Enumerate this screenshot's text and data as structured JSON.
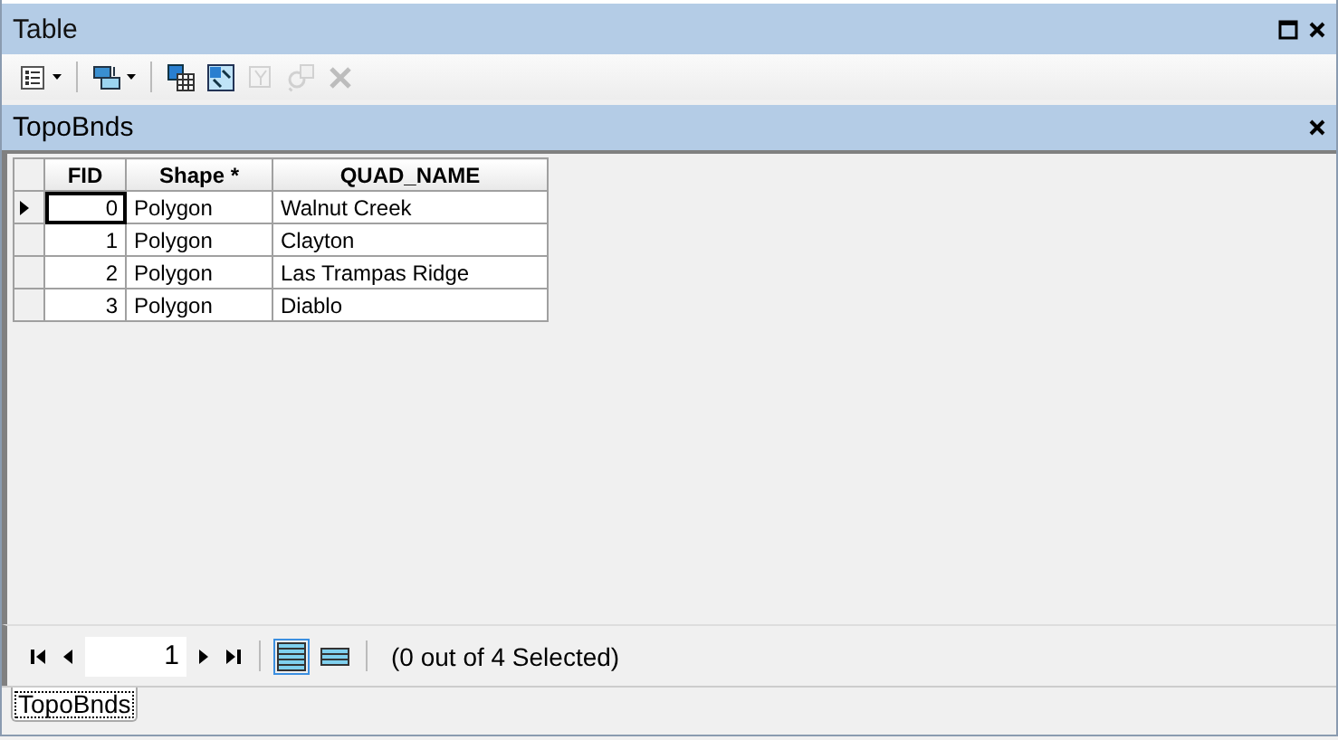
{
  "window": {
    "title": "Table"
  },
  "toolbar": [
    {
      "kind": "options",
      "dropdown": true,
      "disabled": false
    },
    {
      "kind": "related",
      "dropdown": true,
      "disabled": false
    },
    {
      "kind": "select",
      "dropdown": false,
      "disabled": false
    },
    {
      "kind": "switch",
      "dropdown": false,
      "disabled": false
    },
    {
      "kind": "clear",
      "dropdown": false,
      "disabled": true
    },
    {
      "kind": "zoom",
      "dropdown": false,
      "disabled": true
    },
    {
      "kind": "delete",
      "dropdown": false,
      "disabled": true
    }
  ],
  "table_tab": {
    "title": "TopoBnds"
  },
  "table": {
    "columns": [
      {
        "label": "FID"
      },
      {
        "label": "Shape *"
      },
      {
        "label": "QUAD_NAME"
      }
    ],
    "rows": [
      {
        "current": true,
        "cells": [
          "0",
          "Polygon",
          "Walnut Creek"
        ]
      },
      {
        "current": false,
        "cells": [
          "1",
          "Polygon",
          "Clayton"
        ]
      },
      {
        "current": false,
        "cells": [
          "2",
          "Polygon",
          "Las Trampas Ridge"
        ]
      },
      {
        "current": false,
        "cells": [
          "3",
          "Polygon",
          "Diablo"
        ]
      }
    ]
  },
  "navigator": {
    "record": "1",
    "views": [
      {
        "kind": "all",
        "selected": true
      },
      {
        "kind": "selected",
        "selected": false
      }
    ],
    "status": "(0 out of 4 Selected)"
  },
  "tabs": [
    {
      "label": "TopoBnds",
      "selected": true
    }
  ]
}
